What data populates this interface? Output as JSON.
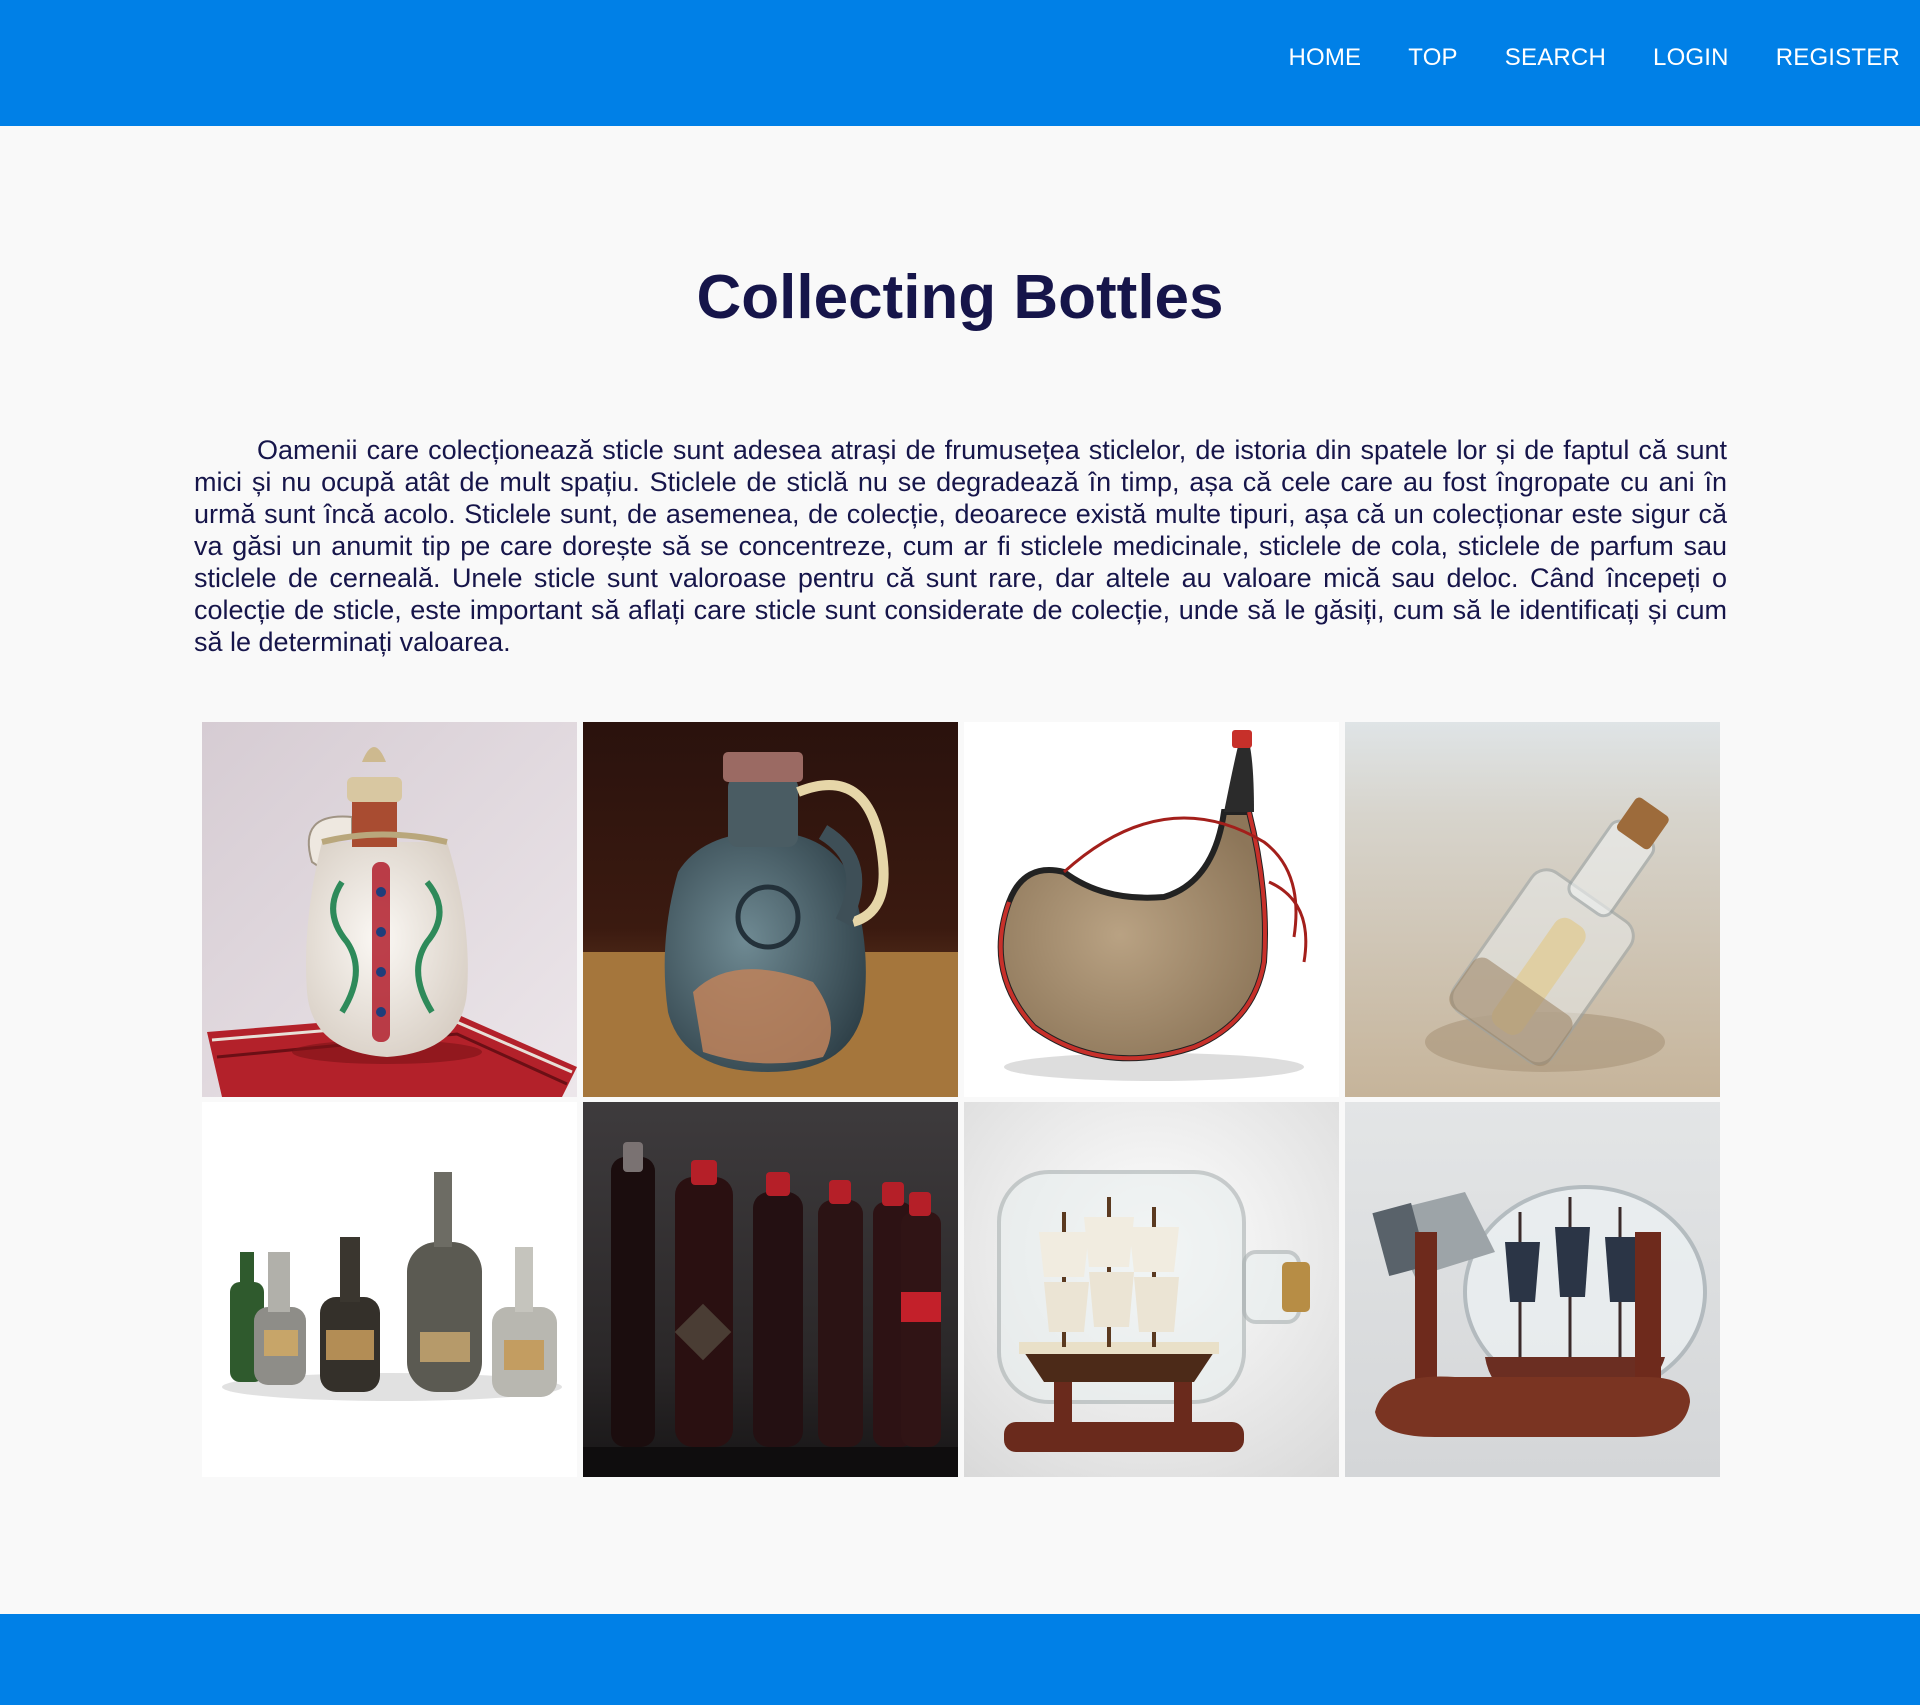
{
  "nav": {
    "items": [
      {
        "label": "HOME"
      },
      {
        "label": "TOP"
      },
      {
        "label": "SEARCH"
      },
      {
        "label": "LOGIN"
      },
      {
        "label": "REGISTER"
      }
    ]
  },
  "main": {
    "title": "Collecting Bottles",
    "intro": "Oamenii care colecționează sticle sunt adesea atrași de frumusețea sticlelor, de istoria din spatele lor și de faptul că sunt mici și nu ocupă atât de mult spațiu. Sticlele de sticlă nu se degradează în timp, așa că cele care au fost îngropate cu ani în urmă sunt încă acolo. Sticlele sunt, de asemenea, de colecție, deoarece există multe tipuri, așa că un colecționar este sigur că va găsi un anumit tip pe care dorește să se concentreze, cum ar fi sticlele medicinale, sticlele de cola, sticlele de parfum sau sticlele de cerneală. Unele sticle sunt valoroase pentru că sunt rare, dar altele au valoare mică sau deloc. Când începeți o colecție de sticle, este important să aflați care sticle sunt considerate de colecție, unde să le găsiți, cum să le identificați și cum să le determinați valoarea."
  },
  "colors": {
    "header": "#0080e7",
    "footer": "#0080e7",
    "title": "#16154a",
    "background": "#f9f9f9"
  }
}
